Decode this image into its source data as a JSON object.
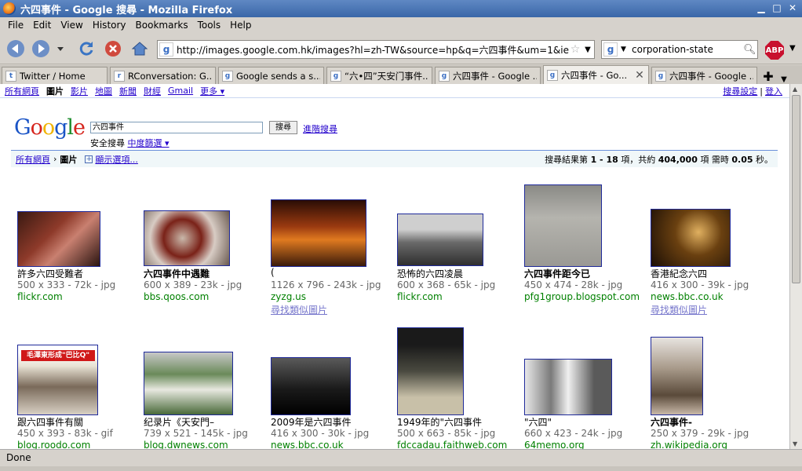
{
  "window": {
    "title": "六四事件 - Google 搜尋 - Mozilla Firefox"
  },
  "menu": [
    "File",
    "Edit",
    "View",
    "History",
    "Bookmarks",
    "Tools",
    "Help"
  ],
  "nav": {
    "url": "http://images.google.com.hk/images?hl=zh-TW&source=hp&q=六四事件&um=1&ie=UTF-",
    "search_query": "corporation-state",
    "abp_label": "ABP"
  },
  "tabs": [
    {
      "label": "Twitter / Home",
      "icon": "t"
    },
    {
      "label": "RConversation: G...",
      "icon": "r"
    },
    {
      "label": "Google sends a s...",
      "icon": "g"
    },
    {
      "label": "“六•四”天安门事件...",
      "icon": "g"
    },
    {
      "label": "六四事件 - Google ...",
      "icon": "g"
    },
    {
      "label": "六四事件 - Go...",
      "icon": "g"
    },
    {
      "label": "六四事件 - Google ...",
      "icon": "g"
    }
  ],
  "gbar": {
    "items": [
      "所有網頁",
      "圖片",
      "影片",
      "地圖",
      "新聞",
      "財經",
      "Gmail",
      "更多 ▾"
    ],
    "right": [
      "搜尋設定",
      "登入"
    ]
  },
  "search": {
    "logo": [
      "G",
      "o",
      "o",
      "g",
      "l",
      "e"
    ],
    "query": "六四事件",
    "button": "搜尋",
    "advanced": "進階搜尋",
    "safe_label": "安全搜尋",
    "safe_link": "中度篩選 ▾"
  },
  "results_bar": {
    "crumb_link": "所有網頁",
    "crumb_sep": "›",
    "crumb_current": "圖片",
    "show_options": "顯示選項...",
    "stats_prefix": "搜尋結果第 ",
    "range": "1 - 18",
    "stats_mid": " 項，共約 ",
    "total": "404,000",
    "stats_mid2": " 項 需時 ",
    "time": "0.05",
    "stats_suffix": " 秒。"
  },
  "images": [
    {
      "caption": "許多六四受難者",
      "meta": "500 x 333 - 72k - jpg",
      "source": "flickr.com",
      "similar": ""
    },
    {
      "caption": "六四事件中遇難",
      "meta": "600 x 389 - 23k - jpg",
      "source": "bbs.qoos.com",
      "similar": ""
    },
    {
      "caption": "(",
      "meta": "1126 x 796 - 243k - jpg",
      "source": "zyzg.us",
      "similar": "尋找類似圖片"
    },
    {
      "caption": "恐怖的六四凌晨",
      "meta": "600 x 368 - 65k - jpg",
      "source": "flickr.com",
      "similar": ""
    },
    {
      "caption": "六四事件距今已",
      "meta": "450 x 474 - 28k - jpg",
      "source": "pfg1group.blogspot.com",
      "similar": ""
    },
    {
      "caption": "香港紀念六四",
      "meta": "416 x 300 - 39k - jpg",
      "source": "news.bbc.co.uk",
      "similar": "尋找類似圖片"
    },
    {
      "caption": "跟六四事件有關",
      "meta": "450 x 393 - 83k - gif",
      "source": "blog.roodo.com",
      "similar": ""
    },
    {
      "caption": "纪录片《天安門–",
      "meta": "739 x 521 - 145k - jpg",
      "source": "blog.dwnews.com",
      "similar": ""
    },
    {
      "caption": "2009年是六四事件",
      "meta": "416 x 300 - 30k - jpg",
      "source": "news.bbc.co.uk",
      "similar": ""
    },
    {
      "caption": "1949年的\"六四事件",
      "meta": "500 x 663 - 85k - jpg",
      "source": "fdccadau.faithweb.com",
      "similar": ""
    },
    {
      "caption": "\"六四\"",
      "meta": "660 x 423 - 24k - jpg",
      "source": "64memo.org",
      "similar": ""
    },
    {
      "caption": "六四事件-",
      "meta": "250 x 379 - 29k - jpg",
      "source": "zh.wikipedia.org",
      "similar": ""
    }
  ],
  "thumb_text": [
    "毛澤東形成\"巴比Q\""
  ],
  "status": "Done"
}
